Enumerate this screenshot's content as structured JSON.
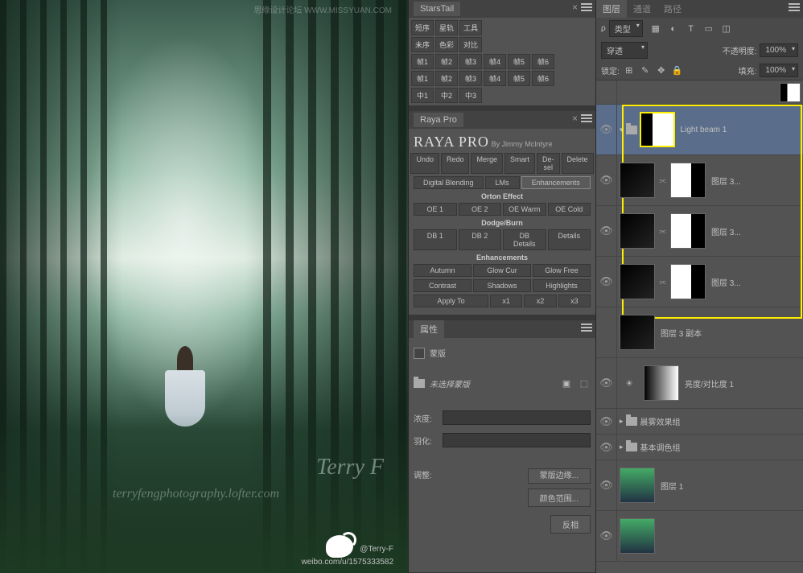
{
  "watermarks": {
    "artist": "Terry F",
    "site": "terryfengphotography.lofter.com",
    "top": "思缘设计论坛 WWW.MISSYUAN.COM",
    "weibo_at": "@Terry-F",
    "weibo_url": "weibo.com/u/1575333582"
  },
  "starstail": {
    "title": "StarsTail",
    "r1": [
      "短序",
      "星轨",
      "工具"
    ],
    "r2": [
      "未序",
      "色彩",
      "对比"
    ],
    "r3": [
      "帧1",
      "帧2",
      "帧3",
      "帧4",
      "帧5",
      "帧6"
    ],
    "r4": [
      "帧1",
      "帧2",
      "帧3",
      "帧4",
      "帧5",
      "帧6"
    ],
    "r5": [
      "中1",
      "中2",
      "中3"
    ]
  },
  "raya": {
    "title": "Raya Pro",
    "panel": "RAYA PRO",
    "by": "By Jimmy McIntyre",
    "row1": [
      "Undo",
      "Redo",
      "Merge",
      "Smart",
      "De-sel",
      "Delete"
    ],
    "tabs": [
      "Digital Blending",
      "LMs",
      "Enhancements"
    ],
    "sec1": "Orton Effect",
    "orton": [
      "OE 1",
      "OE 2",
      "OE Warm",
      "OE Cold"
    ],
    "sec2": "Dodge/Burn",
    "db": [
      "DB 1",
      "DB 2",
      "DB Details",
      "Details"
    ],
    "sec3": "Enhancements",
    "enh1": [
      "Autumn",
      "Glow Cur",
      "Glow Free"
    ],
    "enh2": [
      "Contrast",
      "Shadows",
      "Highlights"
    ],
    "apply": "Apply To"
  },
  "props": {
    "title": "属性",
    "mask_lbl": "蒙版",
    "no_sel": "未选择蒙版",
    "density": "浓度:",
    "feather": "羽化:",
    "adjust": "调整:",
    "btn1": "蒙版边缘...",
    "btn2": "颜色范围...",
    "btn3": "反相"
  },
  "layers_panel": {
    "tabs": [
      "图层",
      "通道",
      "路径"
    ],
    "kind": "类型",
    "blend": "穿透",
    "opacity_lbl": "不透明度:",
    "opacity": "100%",
    "lock": "锁定:",
    "fill_lbl": "填充:",
    "fill": "100%",
    "items": [
      {
        "name": "Light beam 1",
        "sel": true
      },
      {
        "name": "图层 3..."
      },
      {
        "name": "图层 3..."
      },
      {
        "name": "图层 3..."
      },
      {
        "name": "图层 3 副本"
      },
      {
        "name": "亮度/对比度 1"
      },
      {
        "name": "晨雾效果组",
        "group": true
      },
      {
        "name": "基本调色组",
        "group": true
      },
      {
        "name": "图层 1"
      }
    ]
  }
}
